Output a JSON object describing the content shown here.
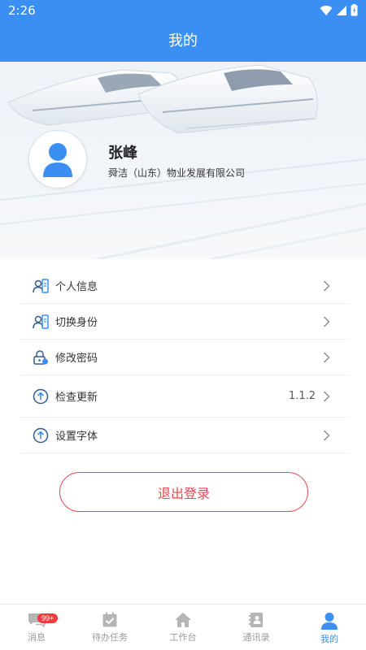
{
  "status_bar": {
    "time": "2:26"
  },
  "header": {
    "title": "我的"
  },
  "profile": {
    "name": "张峰",
    "company": "舜洁（山东）物业发展有限公司"
  },
  "menu": [
    {
      "label": "个人信息",
      "icon": "id-card-icon"
    },
    {
      "label": "切换身份",
      "icon": "switch-identity-icon"
    },
    {
      "label": "修改密码",
      "icon": "lock-icon"
    },
    {
      "label": "检查更新",
      "icon": "upload-arrow-icon",
      "value": "1.1.2"
    },
    {
      "label": "设置字体",
      "icon": "upload-arrow-icon"
    }
  ],
  "logout": {
    "label": "退出登录",
    "color": "#e8474f"
  },
  "tabbar": {
    "tabs": [
      {
        "label": "消息",
        "icon": "chat-icon",
        "badge": "99+"
      },
      {
        "label": "待办任务",
        "icon": "calendar-check-icon"
      },
      {
        "label": "工作台",
        "icon": "home-icon"
      },
      {
        "label": "通讯录",
        "icon": "contacts-book-icon"
      },
      {
        "label": "我的",
        "icon": "user-icon",
        "active": true
      }
    ]
  },
  "colors": {
    "accent": "#3b8ff3",
    "danger": "#e8474f",
    "badge": "#f03c3c"
  }
}
